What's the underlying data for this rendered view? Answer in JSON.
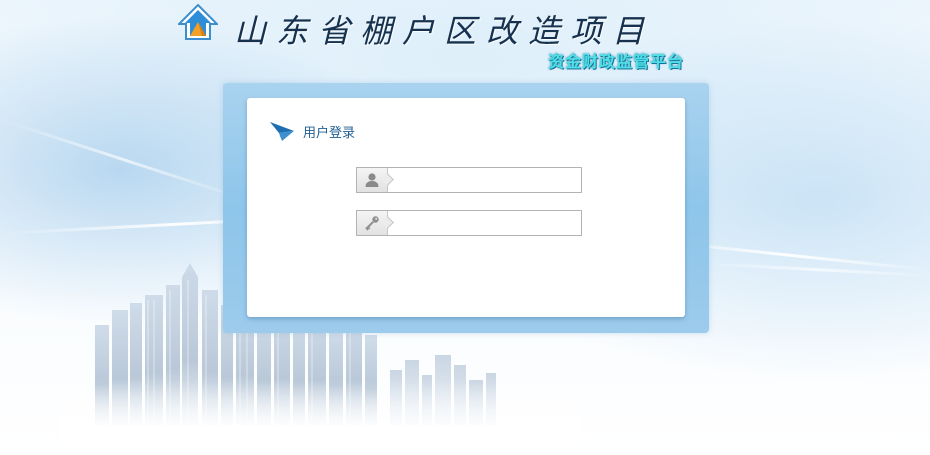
{
  "header": {
    "title": "山东省棚户区改造项目",
    "subtitle": "资金财政监管平台",
    "logo_icon": "house-arrow-icon"
  },
  "login": {
    "title": "用户登录",
    "header_icon": "paper-plane-icon",
    "username": {
      "icon": "user-icon",
      "value": "",
      "placeholder": ""
    },
    "password": {
      "icon": "key-icon",
      "value": "",
      "placeholder": ""
    }
  },
  "colors": {
    "frame": "#8ec5ea",
    "title_text": "#1f5f93",
    "subtitle": "#4fe0e6",
    "main_title": "#16324f"
  }
}
